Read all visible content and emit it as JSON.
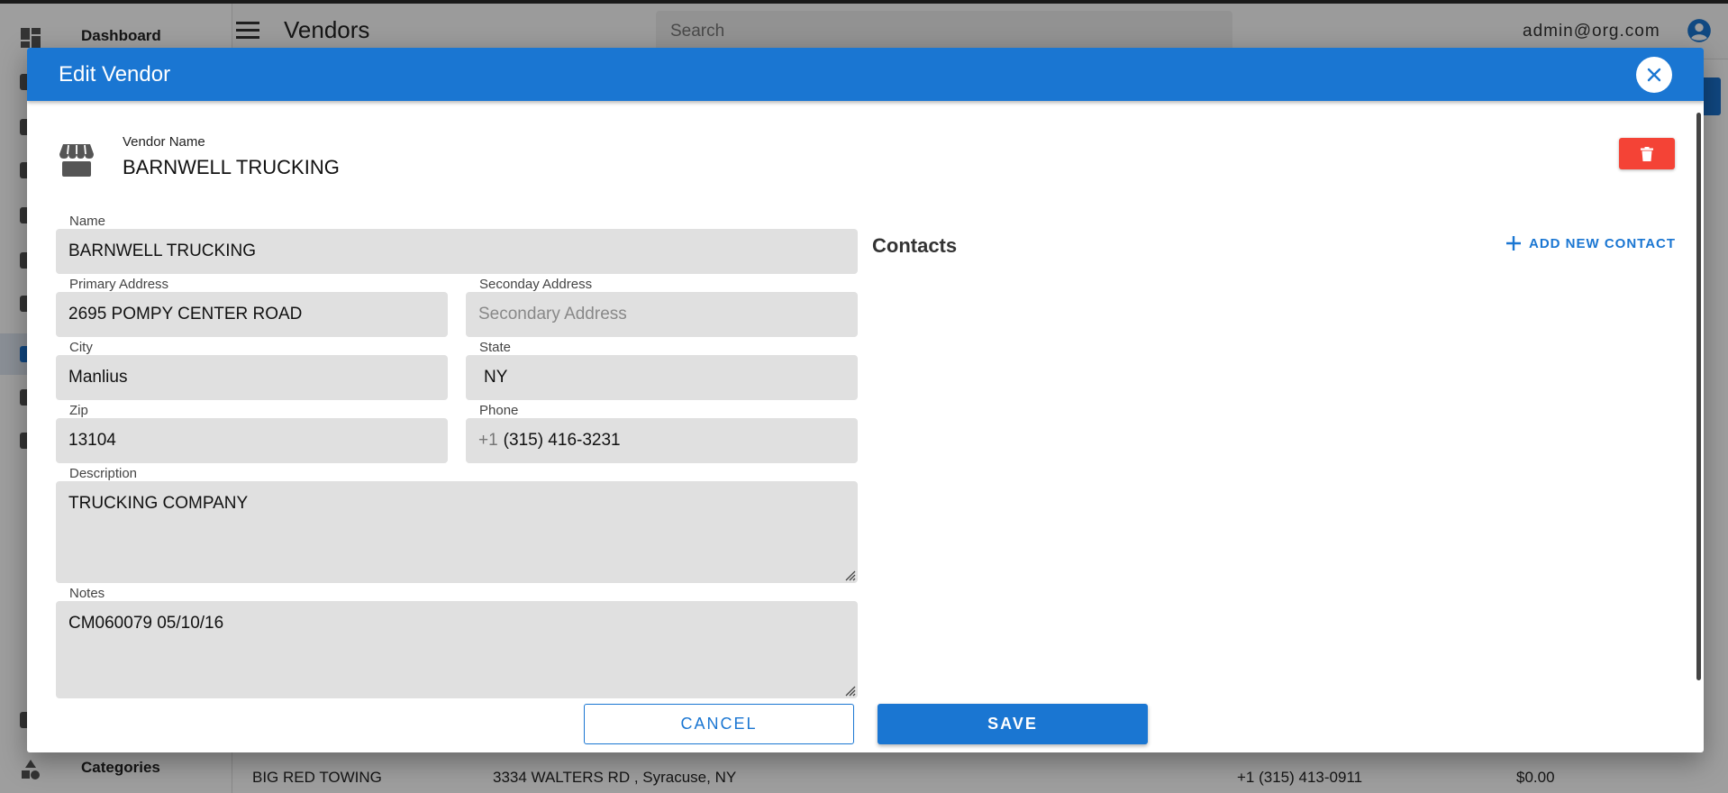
{
  "app": {
    "title": "Vendors",
    "user_email": "admin@org.com",
    "search_placeholder": "Search"
  },
  "sidebar": {
    "items": [
      {
        "label": "Dashboard",
        "icon": "dashboard-icon"
      },
      {
        "label": "Categories",
        "icon": "categories-icon"
      }
    ]
  },
  "background_row": {
    "name": "BIG RED TOWING",
    "address": "3334 WALTERS RD , Syracuse, NY",
    "phone": "+1 (315) 413-0911",
    "amount": "$0.00"
  },
  "modal": {
    "title": "Edit Vendor",
    "vendor_name_label": "Vendor Name",
    "vendor_name_value": "BARNWELL TRUCKING",
    "fields": {
      "name": {
        "label": "Name",
        "value": "BARNWELL TRUCKING"
      },
      "primary_address": {
        "label": "Primary Address",
        "value": "2695 POMPY CENTER ROAD"
      },
      "secondary_address": {
        "label": "Seconday Address",
        "placeholder": "Secondary Address",
        "value": ""
      },
      "city": {
        "label": "City",
        "value": "Manlius"
      },
      "state": {
        "label": "State",
        "value": "NY"
      },
      "zip": {
        "label": "Zip",
        "value": "13104"
      },
      "phone": {
        "label": "Phone",
        "prefix": "+1",
        "value": "(315) 416-3231"
      },
      "description": {
        "label": "Description",
        "value": "TRUCKING COMPANY"
      },
      "notes": {
        "label": "Notes",
        "value": "CM060079 05/10/16"
      }
    },
    "contacts": {
      "title": "Contacts",
      "add_label": "ADD NEW CONTACT"
    },
    "buttons": {
      "cancel": "CANCEL",
      "save": "SAVE"
    }
  },
  "colors": {
    "primary": "#1a76d2",
    "danger": "#f44336",
    "field_bg": "#e0e0e0"
  }
}
